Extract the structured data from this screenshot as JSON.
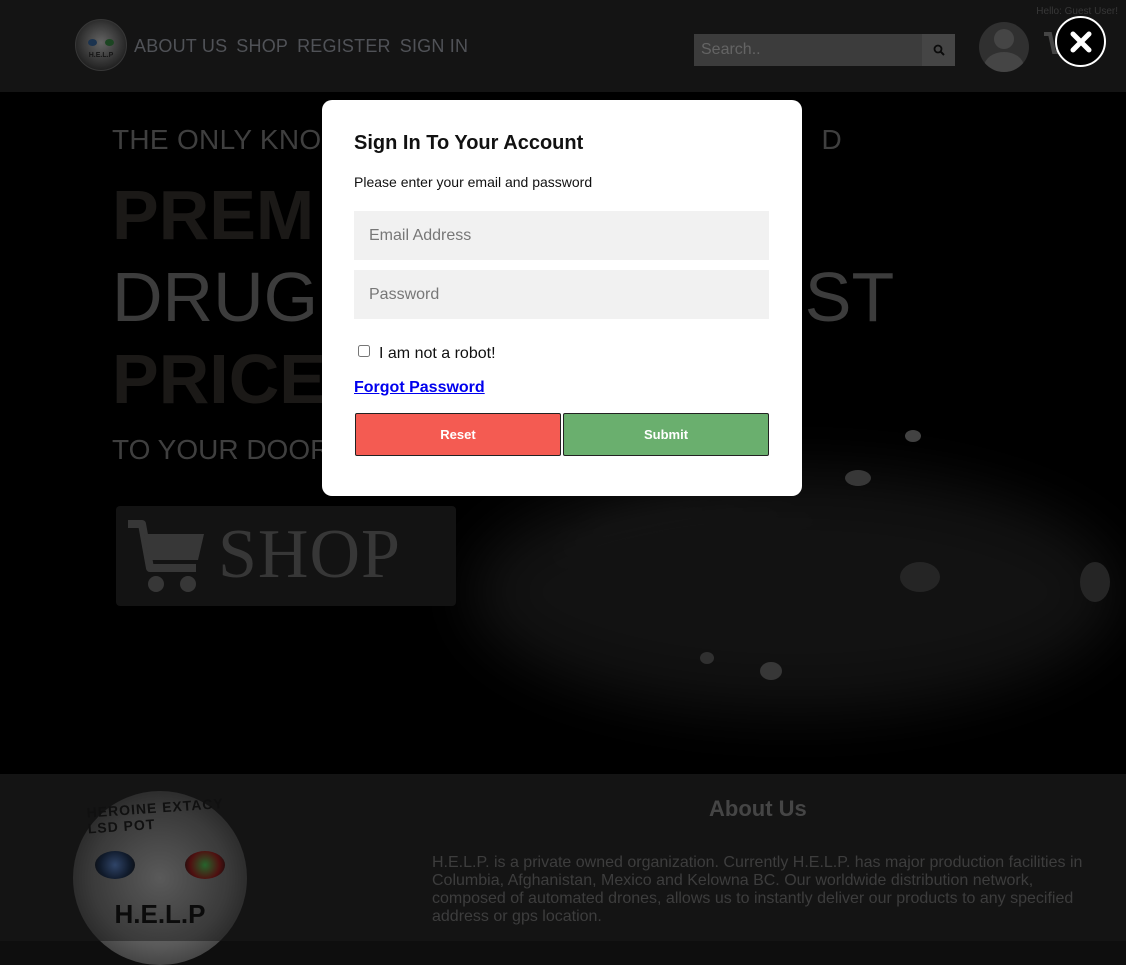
{
  "header": {
    "greeting": "Hello: Guest User!",
    "nav": [
      "ABOUT US",
      "SHOP",
      "REGISTER",
      "SIGN IN"
    ],
    "search_placeholder": "Search.."
  },
  "hero": {
    "line1": "THE ONLY KNO",
    "line1_tail": "D",
    "big_a": "PREM",
    "big_b": "DRUG",
    "big_b_tail": "EST",
    "big_c": "PRICE",
    "line2": "TO YOUR DOOR",
    "shop_label": "SHOP"
  },
  "footer": {
    "logo_ring": "HEROINE EXTACY LSD POT",
    "logo_brand": "H.E.L.P",
    "about_title": "About Us",
    "about_text": "H.E.L.P. is a private owned organization. Currently H.E.L.P. has major production facilities in Columbia, Afghanistan, Mexico and Kelowna BC. Our worldwide distribution network, composed of automated drones, allows us to instantly deliver our products to any specified address or gps location."
  },
  "modal": {
    "title": "Sign In To Your Account",
    "subtitle": "Please enter your email and password",
    "email_placeholder": "Email Address",
    "password_placeholder": "Password",
    "robot_label": "I am not a robot!",
    "forgot_label": "Forgot Password",
    "reset_label": "Reset",
    "submit_label": "Submit"
  },
  "colors": {
    "reset": "#f45b52",
    "submit": "#6aaf6e",
    "link": "#0000ee"
  }
}
